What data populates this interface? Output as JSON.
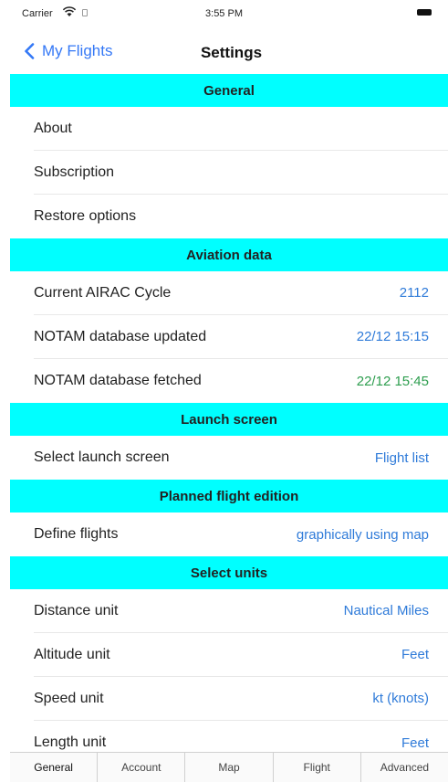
{
  "status_bar": {
    "carrier": "Carrier",
    "time": "3:55 PM"
  },
  "nav": {
    "back_label": "My Flights",
    "title": "Settings"
  },
  "sections": {
    "general": {
      "title": "General",
      "rows": [
        {
          "label": "About"
        },
        {
          "label": "Subscription"
        },
        {
          "label": "Restore options"
        }
      ]
    },
    "aviation": {
      "title": "Aviation data",
      "rows": [
        {
          "label": "Current AIRAC Cycle",
          "value": "2112"
        },
        {
          "label": "NOTAM database updated",
          "value": "22/12 15:15"
        },
        {
          "label": "NOTAM database fetched",
          "value": "22/12 15:45"
        }
      ]
    },
    "launch": {
      "title": "Launch screen",
      "rows": [
        {
          "label": "Select launch screen",
          "value": "Flight list"
        }
      ]
    },
    "planned": {
      "title": "Planned flight edition",
      "rows": [
        {
          "label": "Define flights",
          "value": "graphically using map"
        }
      ]
    },
    "units": {
      "title": "Select units",
      "rows": [
        {
          "label": "Distance unit",
          "value": "Nautical Miles"
        },
        {
          "label": "Altitude unit",
          "value": "Feet"
        },
        {
          "label": "Speed unit",
          "value": "kt (knots)"
        },
        {
          "label": "Length unit",
          "value": "Feet"
        }
      ]
    }
  },
  "tabs": [
    {
      "label": "General"
    },
    {
      "label": "Account"
    },
    {
      "label": "Map"
    },
    {
      "label": "Flight"
    },
    {
      "label": "Advanced"
    }
  ],
  "colors": {
    "section_header": "#00ffff",
    "accent": "#3478f6",
    "value_blue": "#2f7bd9",
    "value_green": "#2e9e4f"
  }
}
